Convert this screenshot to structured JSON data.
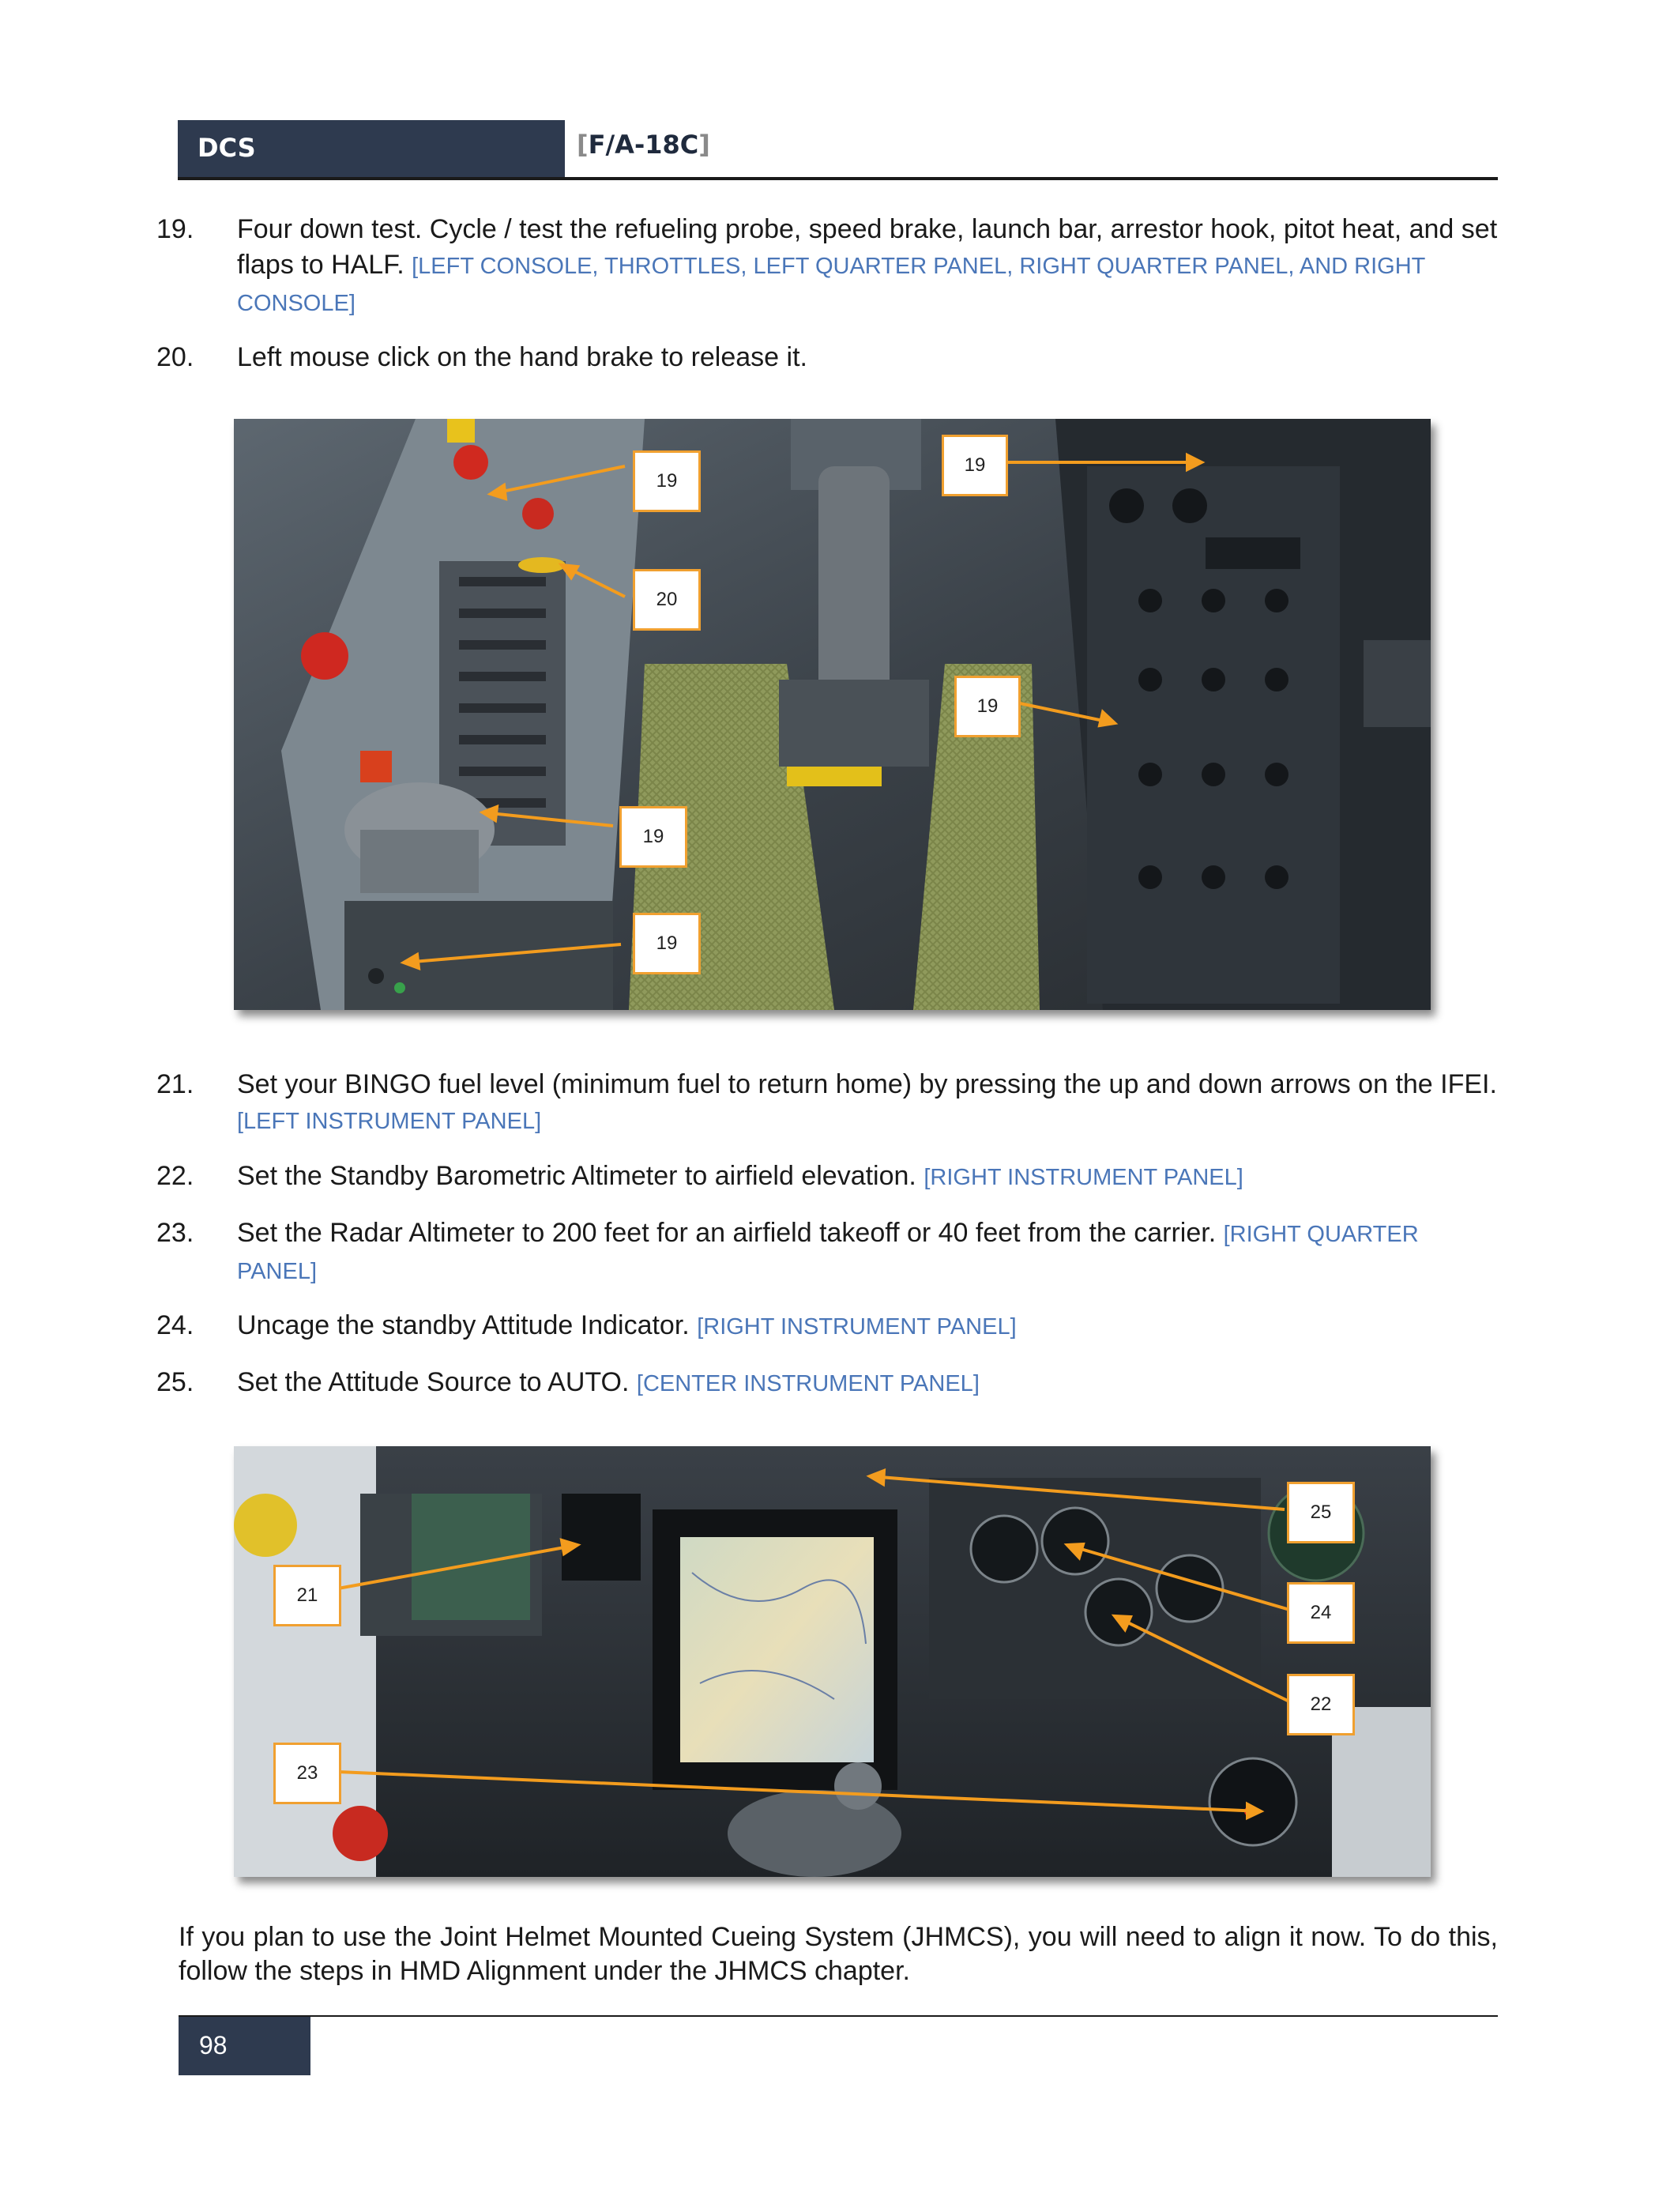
{
  "header": {
    "left_label": "DCS",
    "title": "F/A-18C",
    "bracket_open": "[",
    "bracket_close": "]"
  },
  "steps_top": [
    {
      "num": "19.",
      "text": "Four down test. Cycle / test the refueling probe, speed brake, launch bar, arrestor hook, pitot heat, and set flaps to HALF.",
      "ref": "[LEFT CONSOLE, THROTTLES, LEFT QUARTER PANEL, RIGHT QUARTER PANEL, AND RIGHT CONSOLE]"
    },
    {
      "num": "20.",
      "text": "Left mouse click on the hand brake to release it.",
      "ref": ""
    }
  ],
  "figure1": {
    "callouts": [
      "19",
      "20",
      "19",
      "19",
      "19",
      "19"
    ]
  },
  "steps_mid": [
    {
      "num": "21.",
      "text": "Set your BINGO fuel level (minimum fuel to return home) by pressing the up and down arrows on the IFEI.",
      "ref": "[LEFT INSTRUMENT PANEL]"
    },
    {
      "num": "22.",
      "text": "Set the Standby Barometric Altimeter to airfield elevation.",
      "ref": "[RIGHT INSTRUMENT PANEL]"
    },
    {
      "num": "23.",
      "text": "Set the Radar Altimeter to 200 feet for an airfield takeoff or 40 feet from the carrier.",
      "ref": "[RIGHT QUARTER PANEL]"
    },
    {
      "num": "24.",
      "text": "Uncage the standby Attitude Indicator.",
      "ref": "[RIGHT INSTRUMENT PANEL]"
    },
    {
      "num": "25.",
      "text": "Set the Attitude Source to AUTO.",
      "ref": "[CENTER INSTRUMENT PANEL]"
    }
  ],
  "figure2": {
    "callouts": [
      "25",
      "21",
      "24",
      "22",
      "23"
    ]
  },
  "closing_paragraph": "If you plan to use the Joint Helmet Mounted Cueing System (JHMCS), you will need to align it now. To do this, follow the steps in HMD Alignment under the JHMCS chapter.",
  "footer": {
    "page_number": "98"
  },
  "colors": {
    "header_bg": "#2e3a4f",
    "ref_text": "#4a76b8",
    "callout_border": "#f0a030"
  }
}
